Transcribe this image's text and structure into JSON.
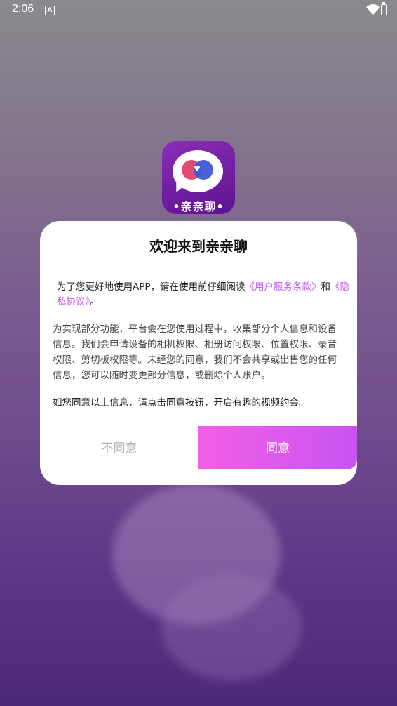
{
  "status_bar": {
    "time": "2:06",
    "notification_letter": "A"
  },
  "app_icon": {
    "label": "•亲亲聊•"
  },
  "dialog": {
    "title": "欢迎来到亲亲聊",
    "para1": {
      "prefix": "为了您更好地使用APP，请在使用前仔细阅读",
      "link_terms": "《用户服务条款》",
      "conjunction": "和",
      "link_privacy": "《隐私协议》",
      "suffix": "。"
    },
    "para2": "为实现部分功能，平台会在您使用过程中，收集部分个人信息和设备信息。我们会申请设备的相机权限、相册访问权限、位置权限、录音权限、剪切板权限等。未经您的同意，我们不会共享或出售您的任何信息，您可以随时变更部分信息，或删除个人账户。",
    "para3": "如您同意以上信息，请点击同意按钮，开启有趣的视频约会。",
    "disagree_label": "不同意",
    "agree_label": "同意"
  },
  "colors": {
    "link": "#c35cf0",
    "agree_gradient_start": "#f25fe6",
    "agree_gradient_end": "#c854f2"
  }
}
